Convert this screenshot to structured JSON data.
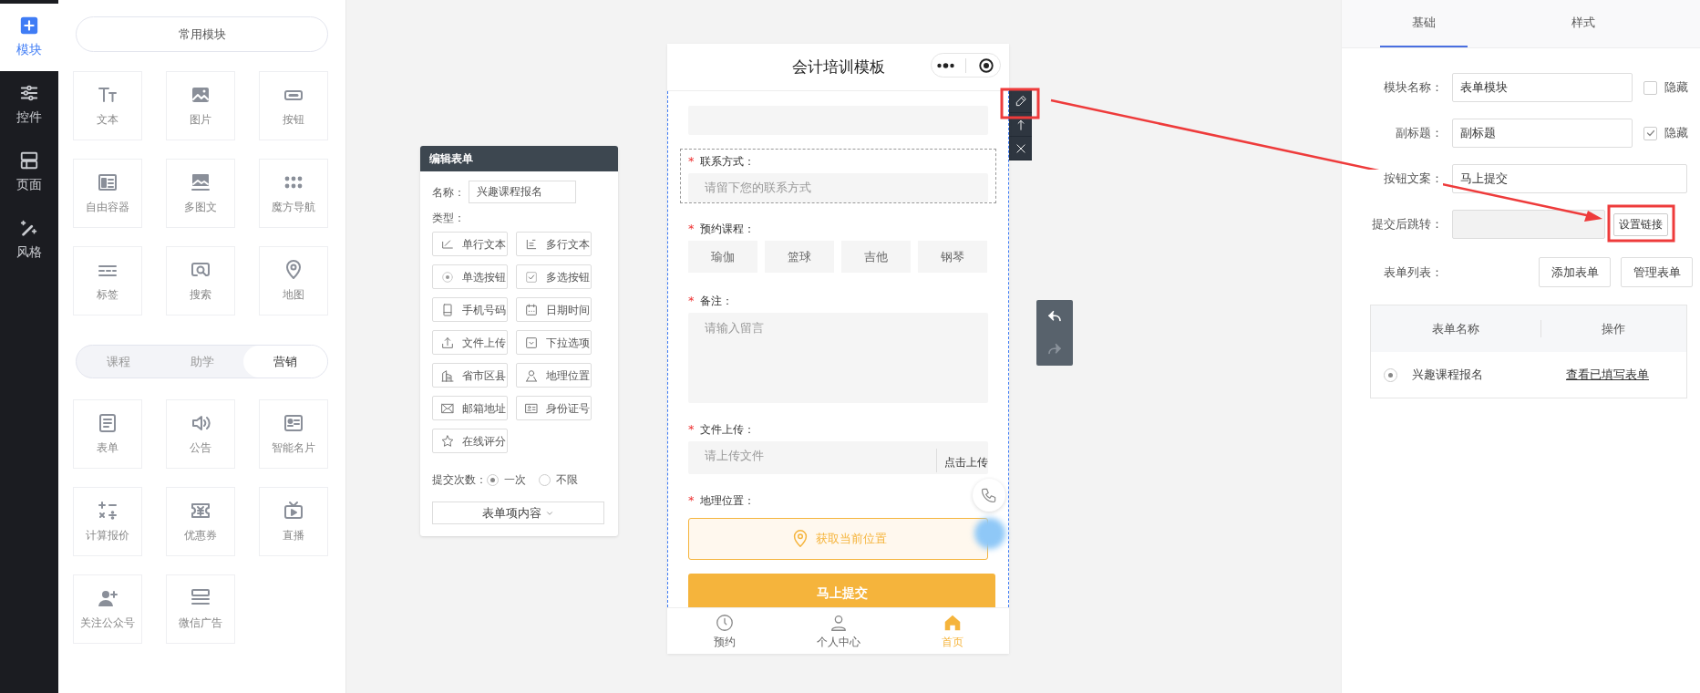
{
  "rail": [
    {
      "label": "模块",
      "selected": true
    },
    {
      "label": "控件",
      "selected": false
    },
    {
      "label": "页面",
      "selected": false
    },
    {
      "label": "风格",
      "selected": false
    }
  ],
  "common_title": "常用模块",
  "common_modules": [
    "文本",
    "图片",
    "按钮",
    "自由容器",
    "多图文",
    "魔方导航",
    "标签",
    "搜索",
    "地图"
  ],
  "module_tabs": [
    {
      "label": "课程",
      "selected": false
    },
    {
      "label": "助学",
      "selected": false
    },
    {
      "label": "营销",
      "selected": true
    }
  ],
  "marketing_modules": [
    "表单",
    "公告",
    "智能名片",
    "计算报价",
    "优惠券",
    "直播",
    "关注公众号",
    "微信广告"
  ],
  "edit_form": {
    "title": "编辑表单",
    "name_label": "名称：",
    "name_value": "兴趣课程报名",
    "type_label": "类型：",
    "types": [
      "单行文本",
      "多行文本",
      "单选按钮",
      "多选按钮",
      "手机号码",
      "日期时间",
      "文件上传",
      "下拉选项",
      "省市区县",
      "地理位置",
      "邮箱地址",
      "身份证号",
      "在线评分"
    ],
    "submit_label": "提交次数：",
    "submit_options": [
      {
        "label": "一次",
        "selected": true
      },
      {
        "label": "不限",
        "selected": false
      }
    ],
    "content_button": "表单项内容"
  },
  "phone": {
    "title": "会计培训模板",
    "fields": [
      {
        "kind": "input",
        "selected": false
      },
      {
        "kind": "input",
        "label": "联系方式：",
        "required_mark": "*",
        "placeholder": "请留下您的联系方式",
        "selected": true
      },
      {
        "kind": "choices",
        "label": "预约课程：",
        "required_mark": "*",
        "options": [
          "瑜伽",
          "篮球",
          "吉他",
          "钢琴"
        ],
        "selected": false
      },
      {
        "kind": "textarea",
        "label": "备注：",
        "required_mark": "*",
        "placeholder": "请输入留言",
        "selected": false
      },
      {
        "kind": "upload",
        "label": "文件上传：",
        "required_mark": "*",
        "placeholder": "请上传文件",
        "action": "点击上传",
        "selected": false
      },
      {
        "kind": "location",
        "label": "地理位置：",
        "required_mark": "*",
        "button": "获取当前位置",
        "selected": false
      }
    ],
    "submit": "马上提交",
    "tabbar": [
      {
        "label": "预约",
        "selected": false
      },
      {
        "label": "个人中心",
        "selected": false
      },
      {
        "label": "首页",
        "selected": true
      }
    ]
  },
  "settings": {
    "tabs": [
      {
        "label": "基础",
        "selected": true
      },
      {
        "label": "样式",
        "selected": false
      }
    ],
    "rows": [
      {
        "label": "模块名称：",
        "value": "表单模块",
        "hide": {
          "label": "隐藏",
          "checked": false
        }
      },
      {
        "label": "副标题：",
        "value": "副标题",
        "hide": {
          "label": "隐藏",
          "checked": true
        }
      },
      {
        "label": "按钮文案：",
        "value": "马上提交"
      },
      {
        "label": "提交后跳转：",
        "disabled": true,
        "button": "设置链接"
      }
    ],
    "form_list": {
      "label": "表单列表：",
      "buttons": [
        "添加表单",
        "管理表单"
      ]
    },
    "table": {
      "columns": [
        "表单名称",
        "操作"
      ],
      "rows": [
        {
          "name": "兴趣课程报名",
          "action": "查看已填写表单",
          "selected": true
        }
      ]
    }
  }
}
